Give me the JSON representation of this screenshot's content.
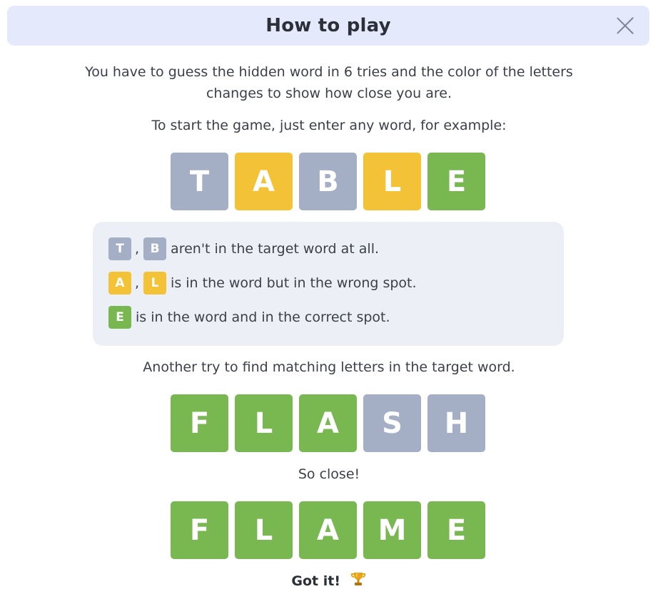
{
  "header": {
    "title": "How to play"
  },
  "intro": {
    "line1": "You have to guess the hidden word in 6 tries and the color of the letters",
    "line2": "changes to show how close you are.",
    "start": "To start the game, just enter any word, for example:"
  },
  "example1": {
    "tiles": [
      {
        "letter": "T",
        "state": "absent"
      },
      {
        "letter": "A",
        "state": "present"
      },
      {
        "letter": "B",
        "state": "absent"
      },
      {
        "letter": "L",
        "state": "present"
      },
      {
        "letter": "E",
        "state": "correct"
      }
    ]
  },
  "legend": {
    "absent": {
      "letters": [
        "T",
        "B"
      ],
      "sep": ",",
      "text": "aren't in the target word at all."
    },
    "present": {
      "letters": [
        "A",
        "L"
      ],
      "sep": ",",
      "text": "is in the word but in the wrong spot."
    },
    "correct": {
      "letters": [
        "E"
      ],
      "text": "is in the word and in the correct spot."
    }
  },
  "another_try": "Another try to find matching letters in the target word.",
  "example2": {
    "tiles": [
      {
        "letter": "F",
        "state": "correct"
      },
      {
        "letter": "L",
        "state": "correct"
      },
      {
        "letter": "A",
        "state": "correct"
      },
      {
        "letter": "S",
        "state": "absent"
      },
      {
        "letter": "H",
        "state": "absent"
      }
    ]
  },
  "so_close": "So close!",
  "example3": {
    "tiles": [
      {
        "letter": "F",
        "state": "correct"
      },
      {
        "letter": "L",
        "state": "correct"
      },
      {
        "letter": "A",
        "state": "correct"
      },
      {
        "letter": "M",
        "state": "correct"
      },
      {
        "letter": "E",
        "state": "correct"
      }
    ]
  },
  "got_it": {
    "label": "Got it!",
    "icon": "trophy-icon"
  },
  "colors": {
    "absent": "#a4aec4",
    "present": "#f3c237",
    "correct": "#79b851",
    "header_bg": "#e4eafc",
    "legend_bg": "#eceff5"
  }
}
